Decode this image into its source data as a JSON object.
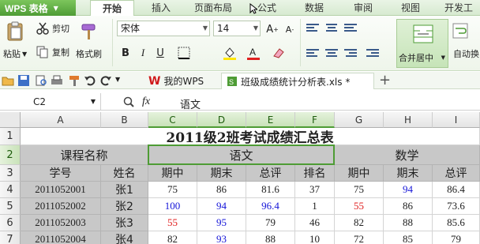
{
  "app": {
    "name": "WPS 表格",
    "menu_icon": "caret-down-icon"
  },
  "menu_tabs": [
    "开始",
    "插入",
    "页面布局",
    "公式",
    "数据",
    "审阅",
    "视图",
    "开发工"
  ],
  "ribbon": {
    "paste": "粘贴",
    "cut": "剪切",
    "copy": "复制",
    "format_painter": "格式刷",
    "font_name": "宋体",
    "font_size": "14",
    "merge_center": "合并居中",
    "auto_wrap": "自动换"
  },
  "quickbar": {
    "my_wps": "我的WPS",
    "doc_name": "班级成绩统计分析表.xls *",
    "add_tab": "+"
  },
  "formula_bar": {
    "cell_ref": "C2",
    "fx": "fx",
    "content": "语文"
  },
  "sheet": {
    "columns": [
      "A",
      "B",
      "C",
      "D",
      "E",
      "F",
      "G",
      "H",
      "I"
    ],
    "rows": [
      "1",
      "2",
      "3",
      "4",
      "5",
      "6",
      "7"
    ],
    "title": "2011级2班考试成绩汇总表",
    "row2": {
      "course": "课程名称",
      "chinese": "语文",
      "math": "数学"
    },
    "row3": [
      "学号",
      "姓名",
      "期中",
      "期末",
      "总评",
      "排名",
      "期中",
      "期末",
      "总评"
    ],
    "data": [
      [
        "2011052001",
        "张1",
        "75",
        "86",
        "81.6",
        "37",
        "75",
        "94",
        "86.4"
      ],
      [
        "2011052002",
        "张2",
        "100",
        "94",
        "96.4",
        "1",
        "55",
        "86",
        "73.6"
      ],
      [
        "2011052003",
        "张3",
        "55",
        "95",
        "79",
        "46",
        "82",
        "88",
        "85.6"
      ],
      [
        "2011052004",
        "张4",
        "82",
        "93",
        "88",
        "10",
        "72",
        "85",
        "79"
      ]
    ]
  },
  "colors": {
    "accent": "#4e9c35",
    "blue_text": "#1515d8",
    "red_text": "#e02020",
    "gray_fill": "#c8c8c8"
  }
}
